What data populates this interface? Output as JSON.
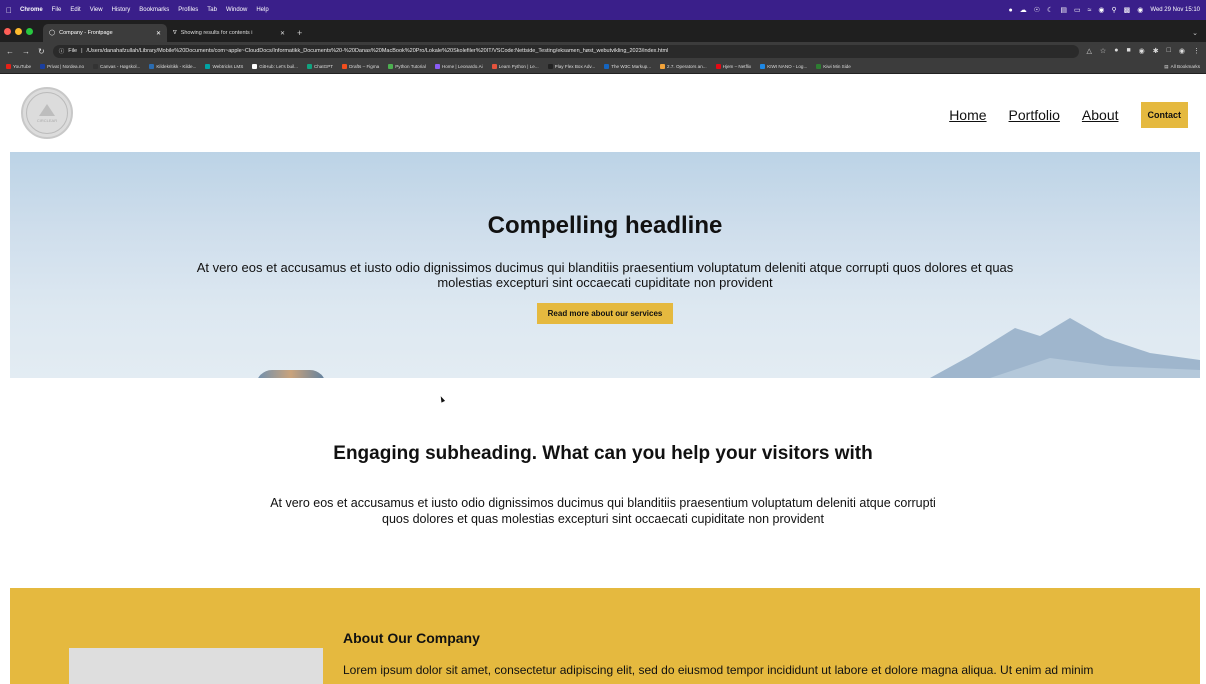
{
  "menubar": {
    "app": "Chrome",
    "items": [
      "File",
      "Edit",
      "View",
      "History",
      "Bookmarks",
      "Profiles",
      "Tab",
      "Window",
      "Help"
    ],
    "datetime": "Wed 29 Nov 15:10"
  },
  "tabs": [
    {
      "label": "Company - Frontpage"
    },
    {
      "label": "Showing results for contents i"
    }
  ],
  "address": {
    "prefix": "File",
    "url": "/Users/danahafzullah/Library/Mobile%20Documents/com~apple~CloudDocs/Informatikk_Documents%20-%20Danas%20MacBook%20Pro/Lokale%20Skolefiler%20IT/VSCode:Nettside_Testing/eksamen_høst_webutvikling_2023/index.html"
  },
  "bookmarks": [
    {
      "label": "YouTube",
      "color": "#e62117"
    },
    {
      "label": "Privat | Nordea.no",
      "color": "#1a3fa0"
    },
    {
      "label": "Canvas - Høgskol...",
      "color": "#333333"
    },
    {
      "label": "Kildekritikk - Kilde...",
      "color": "#2b6cb0"
    },
    {
      "label": "Webtricks LMS",
      "color": "#00a3a3"
    },
    {
      "label": "GitHub: Let's buil...",
      "color": "#ffffff"
    },
    {
      "label": "ChatGPT",
      "color": "#10a37f"
    },
    {
      "label": "Drafts – Figma",
      "color": "#f24e1e"
    },
    {
      "label": "Python Tutorial",
      "color": "#4caf50"
    },
    {
      "label": "Home | Leonardo.Ai",
      "color": "#8a5cf6"
    },
    {
      "label": "Learn Python | Le...",
      "color": "#e5533d"
    },
    {
      "label": "Play Flex Box Adv...",
      "color": "#222222"
    },
    {
      "label": "The W3C Markup...",
      "color": "#1565c0"
    },
    {
      "label": "2.7. Operators an...",
      "color": "#f2a33a"
    },
    {
      "label": "Hjem – Netflix",
      "color": "#e50914"
    },
    {
      "label": "KIWI NANO - Log...",
      "color": "#1e88e5"
    },
    {
      "label": "Kiwi Min Side",
      "color": "#2e7d32"
    }
  ],
  "bookmarks_right": "All Bookmarks",
  "site": {
    "logo_text": "CIRCLEAR",
    "nav": [
      {
        "label": "Home"
      },
      {
        "label": "Portfolio"
      },
      {
        "label": "About"
      }
    ],
    "contact_label": "Contact",
    "hero": {
      "title": "Compelling headline",
      "text": "At vero eos et accusamus et iusto odio dignissimos ducimus qui blanditiis praesentium voluptatum deleniti atque corrupti quos dolores et quas molestias excepturi sint occaecati cupiditate non provident",
      "cta": "Read more about our services"
    },
    "sub": {
      "title": "Engaging subheading. What can you help your visitors with",
      "text": "At vero eos et accusamus et iusto odio dignissimos ducimus qui blanditiis praesentium voluptatum deleniti atque corrupti quos dolores et quas molestias excepturi sint occaecati cupiditate non provident"
    },
    "about": {
      "title": "About Our Company",
      "text": "Lorem ipsum dolor sit amet, consectetur adipiscing elit, sed do eiusmod tempor incididunt ut labore et dolore magna aliqua. Ut enim ad minim"
    },
    "accent_color": "#e5b93f"
  }
}
